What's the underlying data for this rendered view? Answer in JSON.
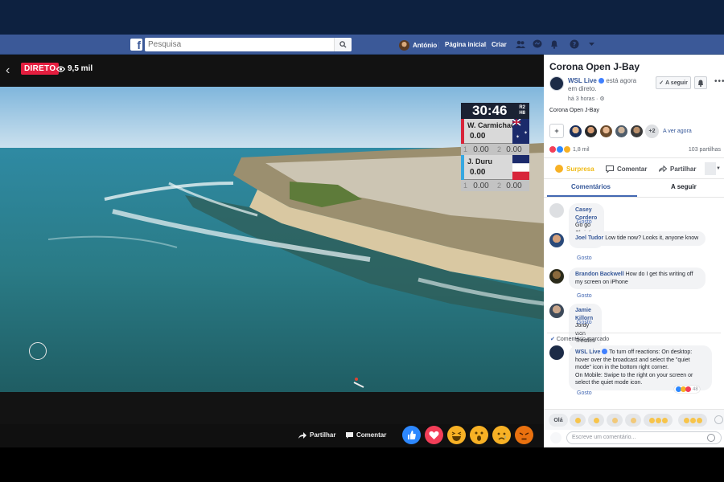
{
  "fbbar": {
    "search_placeholder": "Pesquisa",
    "user_name": "António",
    "home_label": "Página inicial",
    "create_label": "Criar"
  },
  "video": {
    "live_label": "DIRETO",
    "viewer_count": "9,5 mil",
    "scoreboard": {
      "timer": "30:46",
      "round_line1": "R2",
      "round_line2": "H8",
      "surfers": [
        {
          "name": "W. Carmichael",
          "total": "0.00",
          "wave1_no": "1",
          "wave1": "0.00",
          "wave2_no": "2",
          "wave2": "0.00",
          "color": "#d8253a"
        },
        {
          "name": "J. Duru",
          "total": "0.00",
          "wave1_no": "1",
          "wave1": "0.00",
          "wave2_no": "2",
          "wave2": "0.00",
          "color": "#37a8e0"
        }
      ]
    },
    "share_label": "Partilhar",
    "comment_label": "Comentar"
  },
  "panel": {
    "title": "Corona Open J-Bay",
    "page_name": "WSL Live",
    "status_text": " está agora em direto.",
    "time_text": "há 3 horas · ",
    "follow_label": "A seguir",
    "description": "Corona Open J-Bay",
    "plus_more": "+2",
    "watching_label": "A ver agora",
    "reactions_count": "1,8 mil",
    "shares_count": "103 partilhas",
    "action_reaction": "Surpresa",
    "action_comment": "Comentar",
    "action_share": "Partilhar",
    "tab_comments": "Comentários",
    "tab_following": "A seguir",
    "like_label": "Gosto",
    "comments": [
      {
        "name": "Casey Cordero",
        "text": "Go go Christian Slater"
      },
      {
        "name": "Joel Tudor",
        "text": "Low tide now? Looks it, anyone know"
      },
      {
        "name": "Brandon Backwell",
        "text": "How do I get this writing off my screen on iPhone"
      },
      {
        "name": "Jamie Killorn",
        "text": "Jordy won Trestles"
      }
    ],
    "pinned_label": "Comentário marcado",
    "pinned": {
      "name": "WSL Live",
      "text": "To turn off reactions: On desktop: hover over the broadcast and select the \"quiet mode\" icon in the bottom right corner.",
      "text2": "On Mobile: Swipe to the right on your screen or select the quiet mode icon.",
      "reaction_count": "48"
    },
    "quick_hello": "Olá",
    "compose_placeholder": "Escreve um comentário..."
  },
  "colors": {
    "fb_blue": "#3b5998",
    "live_red": "#e41e3f",
    "link_blue": "#365899"
  }
}
